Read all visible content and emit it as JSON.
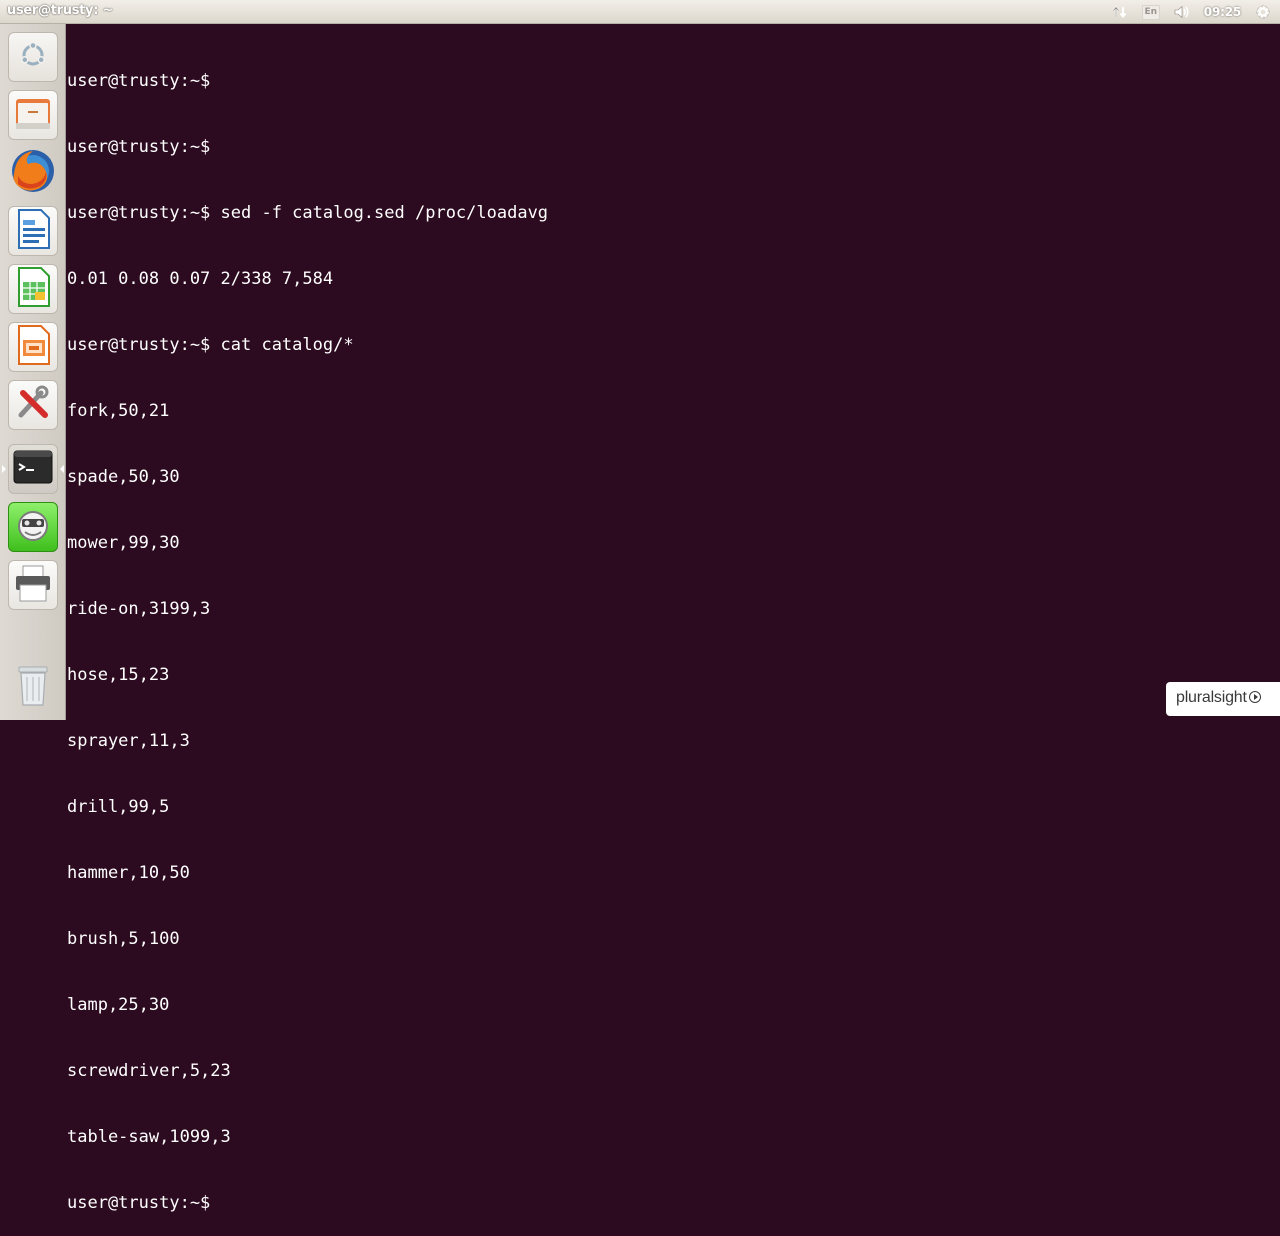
{
  "panel": {
    "window_title": "user@trusty: ~",
    "keyboard_layout": "En",
    "clock": "09:25",
    "icons": [
      "network-arrows-icon",
      "keyboard-layout-icon",
      "volume-icon",
      "gear-icon"
    ]
  },
  "launcher": {
    "items": [
      {
        "name": "dash-home-button",
        "icon": "ubuntu-logo-icon"
      },
      {
        "name": "files-button",
        "icon": "files-icon"
      },
      {
        "name": "firefox-button",
        "icon": "firefox-icon"
      },
      {
        "name": "writer-button",
        "icon": "writer-icon"
      },
      {
        "name": "calc-button",
        "icon": "calc-icon"
      },
      {
        "name": "impress-button",
        "icon": "impress-icon"
      },
      {
        "name": "settings-button",
        "icon": "settings-tools-icon"
      },
      {
        "name": "terminal-button",
        "icon": "terminal-icon"
      },
      {
        "name": "recorder-button",
        "icon": "recorder-icon"
      },
      {
        "name": "printer-button",
        "icon": "printer-icon"
      },
      {
        "name": "trash-button",
        "icon": "trash-icon"
      }
    ]
  },
  "terminal": {
    "lines": [
      "user@trusty:~$",
      "user@trusty:~$",
      "user@trusty:~$ sed -f catalog.sed /proc/loadavg",
      "0.01 0.08 0.07 2/338 7,584",
      "user@trusty:~$ cat catalog/*",
      "fork,50,21",
      "spade,50,30",
      "mower,99,30",
      "ride-on,3199,3",
      "hose,15,23",
      "sprayer,11,3",
      "drill,99,5",
      "hammer,10,50",
      "brush,5,100",
      "lamp,25,30",
      "screwdriver,5,23",
      "table-saw,1099,3",
      "user@trusty:~$"
    ]
  },
  "watermark": {
    "text": "pluralsight"
  },
  "colors": {
    "terminal_bg": "#2c0a1f",
    "terminal_fg": "#ffffff",
    "panel_bg": "#dcd7cc",
    "launcher_bg": "#d6d2cb",
    "active_green": "#3fbf1d"
  }
}
